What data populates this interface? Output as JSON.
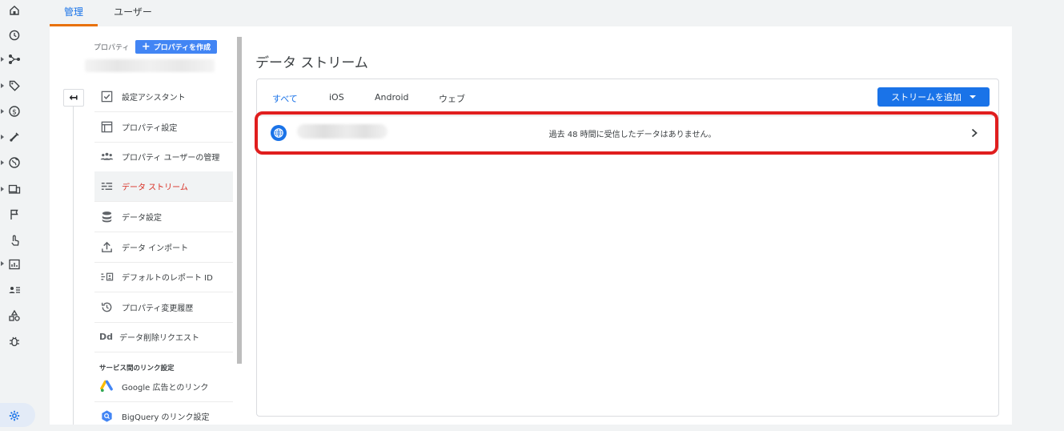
{
  "tabs": {
    "admin": "管理",
    "user": "ユーザー"
  },
  "property_panel": {
    "label": "プロパティ",
    "create_button": "プロパティを作成",
    "create_plus": "+"
  },
  "nav": {
    "back": "↤",
    "items": [
      {
        "label": "設定アシスタント",
        "icon": "checklist-icon"
      },
      {
        "label": "プロパティ設定",
        "icon": "property-settings-icon"
      },
      {
        "label": "プロパティ ユーザーの管理",
        "icon": "users-icon"
      },
      {
        "label": "データ ストリーム",
        "icon": "data-streams-icon",
        "active": true
      },
      {
        "label": "データ設定",
        "icon": "database-icon"
      },
      {
        "label": "データ インポート",
        "icon": "upload-icon"
      },
      {
        "label": "デフォルトのレポート ID",
        "icon": "reporting-id-icon"
      },
      {
        "label": "プロパティ変更履歴",
        "icon": "history-icon"
      },
      {
        "label": "データ削除リクエスト",
        "icon": "data-deletion-icon"
      }
    ],
    "section_title": "サービス間のリンク設定",
    "link_items": [
      {
        "label": "Google 広告とのリンク",
        "icon": "google-ads-icon"
      },
      {
        "label": "BigQuery のリンク設定",
        "icon": "bigquery-icon"
      }
    ],
    "data_deletion_glyph": "Dd"
  },
  "main": {
    "title": "データ ストリーム",
    "subtabs": [
      "すべて",
      "iOS",
      "Android",
      "ウェブ"
    ],
    "add_stream_button": "ストリームを追加",
    "stream_row": {
      "status": "過去 48 時間に受信したデータはありません。"
    }
  },
  "colors": {
    "accent": "#1a73e8",
    "active_nav": "#d93025",
    "tab_indicator": "#e8710a",
    "highlight": "#e01e1e"
  }
}
